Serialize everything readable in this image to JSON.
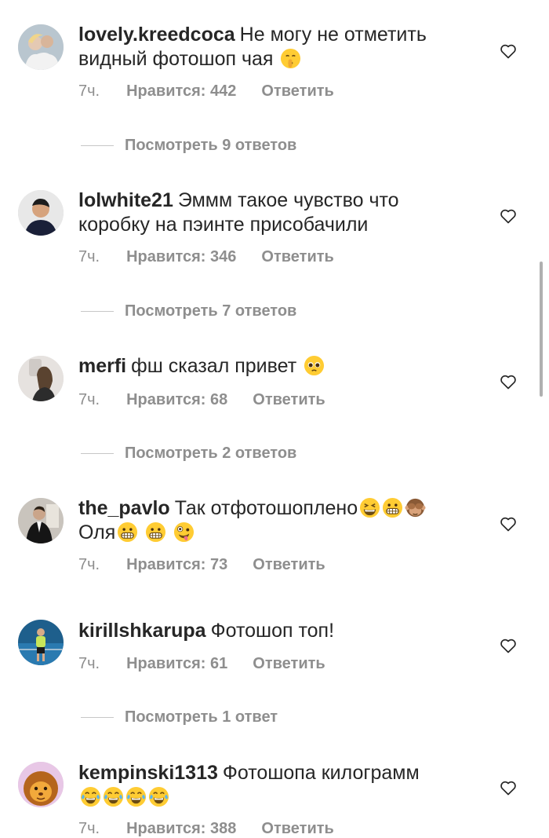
{
  "comments": [
    {
      "username": "lovely.kreedcoca",
      "text": "Не могу не отметить видный фотошоп чая",
      "emojis": [
        "shushing-face"
      ],
      "time": "7ч.",
      "likes": "Нравится: 442",
      "reply": "Ответить",
      "view_replies": "Посмотреть 9 ответов"
    },
    {
      "username": "lolwhite21",
      "text": "Эммм такое чувство что коробку на пэинте присобачили",
      "emojis": [],
      "time": "7ч.",
      "likes": "Нравится: 346",
      "reply": "Ответить",
      "view_replies": "Посмотреть 7 ответов"
    },
    {
      "username": "merfi",
      "text": "фш сказал привет",
      "emojis": [
        "pleading-face"
      ],
      "time": "7ч.",
      "likes": "Нравится: 68",
      "reply": "Ответить",
      "view_replies": "Посмотреть 2 ответов"
    },
    {
      "username": "the_pavlo",
      "text": "Так отфотошоплено",
      "text2": "Оля",
      "emojis": [
        "grinning-squint-face",
        "grimacing-face",
        "see-no-evil-monkey"
      ],
      "emojis2": [
        "grimacing-face",
        "grimacing-face",
        "zany-face"
      ],
      "time": "7ч.",
      "likes": "Нравится: 73",
      "reply": "Ответить"
    },
    {
      "username": "kirillshkarupa",
      "text": "Фотошоп топ!",
      "emojis": [],
      "time": "7ч.",
      "likes": "Нравится: 61",
      "reply": "Ответить",
      "view_replies": "Посмотреть 1 ответ"
    },
    {
      "username": "kempinski1313",
      "text": "Фотошопа килограмм",
      "emojis": [
        "tears-of-joy-face",
        "tears-of-joy-face",
        "tears-of-joy-face",
        "tears-of-joy-face"
      ],
      "time": "7ч.",
      "likes": "Нравится: 388",
      "reply": "Ответить"
    }
  ],
  "colors": {
    "text": "#262626",
    "secondary": "#8e8e8e",
    "emoji_yellow": "#ffcc33"
  },
  "icons": {
    "like": "heart-outline-icon"
  }
}
